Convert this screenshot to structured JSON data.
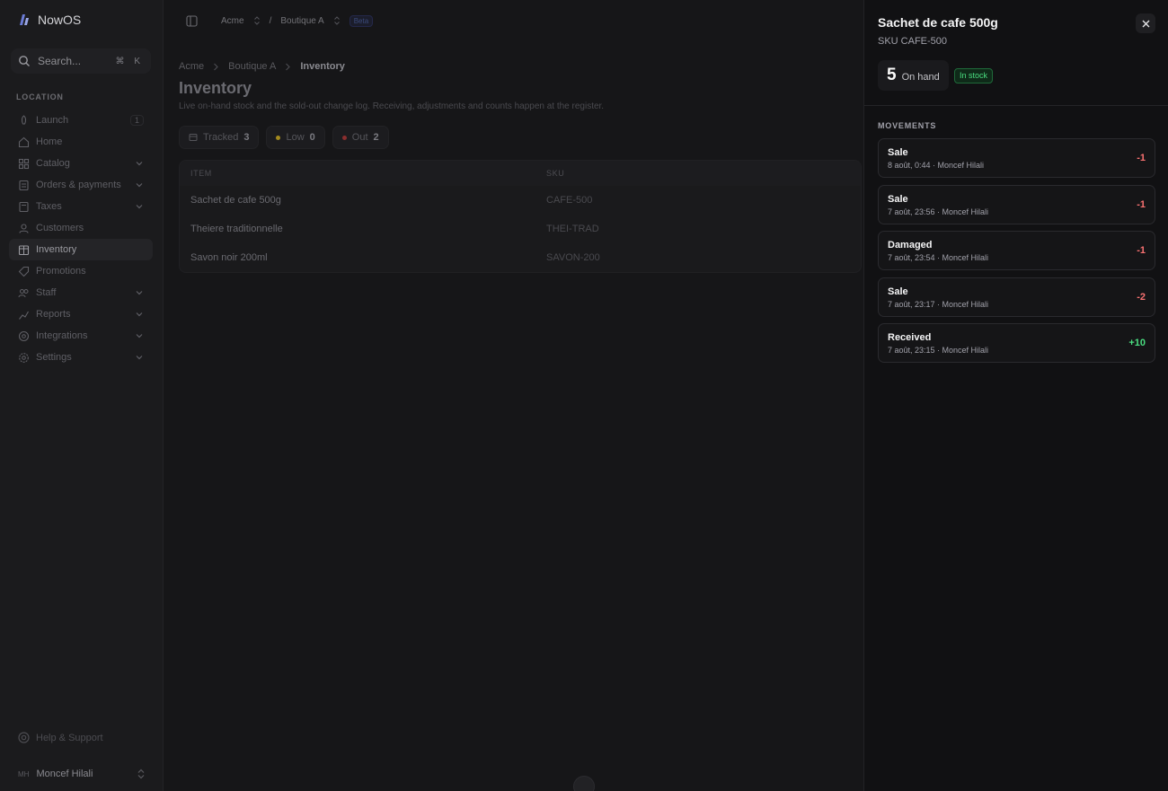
{
  "brand": {
    "name": "NowOS"
  },
  "search": {
    "placeholder": "Search...",
    "shortcut": "⌘ K"
  },
  "sidebar": {
    "section_label": "LOCATION",
    "items": [
      {
        "label": "Launch",
        "icon": "rocket-icon",
        "badge": "1",
        "expandable": false
      },
      {
        "label": "Home",
        "icon": "home-icon",
        "expandable": false
      },
      {
        "label": "Catalog",
        "icon": "catalog-icon",
        "expandable": true
      },
      {
        "label": "Orders & payments",
        "icon": "orders-icon",
        "expandable": true
      },
      {
        "label": "Taxes",
        "icon": "taxes-icon",
        "expandable": true
      },
      {
        "label": "Customers",
        "icon": "customers-icon",
        "expandable": false
      },
      {
        "label": "Inventory",
        "icon": "inventory-icon",
        "expandable": false,
        "active": true
      },
      {
        "label": "Promotions",
        "icon": "promotions-icon",
        "expandable": false
      },
      {
        "label": "Staff",
        "icon": "staff-icon",
        "expandable": true
      },
      {
        "label": "Reports",
        "icon": "reports-icon",
        "expandable": true
      },
      {
        "label": "Integrations",
        "icon": "integrations-icon",
        "expandable": true
      },
      {
        "label": "Settings",
        "icon": "settings-icon",
        "expandable": true
      }
    ],
    "help_label": "Help & Support",
    "user": {
      "initials": "MH",
      "name": "Moncef Hilali"
    }
  },
  "topbar": {
    "org": "Acme",
    "separator": "/",
    "location": "Boutique A",
    "env_badge": "Beta"
  },
  "main": {
    "breadcrumb": [
      "Acme",
      "Boutique A",
      "Inventory"
    ],
    "title": "Inventory",
    "subtitle": "Live on-hand stock and the sold-out change log. Receiving, adjustments and counts happen at the register.",
    "pills": [
      {
        "label": "Tracked",
        "count": "3",
        "color": ""
      },
      {
        "label": "Low",
        "count": "0",
        "color": "#a38a1e"
      },
      {
        "label": "Out",
        "count": "2",
        "color": "#8a2e2e"
      }
    ],
    "table": {
      "headers": [
        "ITEM",
        "SKU"
      ],
      "rows": [
        {
          "item": "Sachet de cafe 500g",
          "sku": "CAFE-500"
        },
        {
          "item": "Theiere traditionnelle",
          "sku": "THEI-TRAD"
        },
        {
          "item": "Savon noir 200ml",
          "sku": "SAVON-200"
        }
      ]
    }
  },
  "drawer": {
    "title": "Sachet de cafe 500g",
    "sku": "SKU CAFE-500",
    "on_hand_count": "5",
    "on_hand_label": "On hand",
    "status": "In stock",
    "movements_label": "MOVEMENTS",
    "movements": [
      {
        "type": "Sale",
        "meta": "8 août, 0:44 · Moncef Hilali",
        "qty": "-1",
        "sign": "neg"
      },
      {
        "type": "Sale",
        "meta": "7 août, 23:56 · Moncef Hilali",
        "qty": "-1",
        "sign": "neg"
      },
      {
        "type": "Damaged",
        "meta": "7 août, 23:54 · Moncef Hilali",
        "qty": "-1",
        "sign": "neg"
      },
      {
        "type": "Sale",
        "meta": "7 août, 23:17 · Moncef Hilali",
        "qty": "-2",
        "sign": "neg"
      },
      {
        "type": "Received",
        "meta": "7 août, 23:15 · Moncef Hilali",
        "qty": "+10",
        "sign": "pos"
      }
    ]
  },
  "colors": {
    "accent_positive": "#4ade80",
    "accent_negative": "#f87171",
    "badge_bg": "#0f2a19"
  }
}
